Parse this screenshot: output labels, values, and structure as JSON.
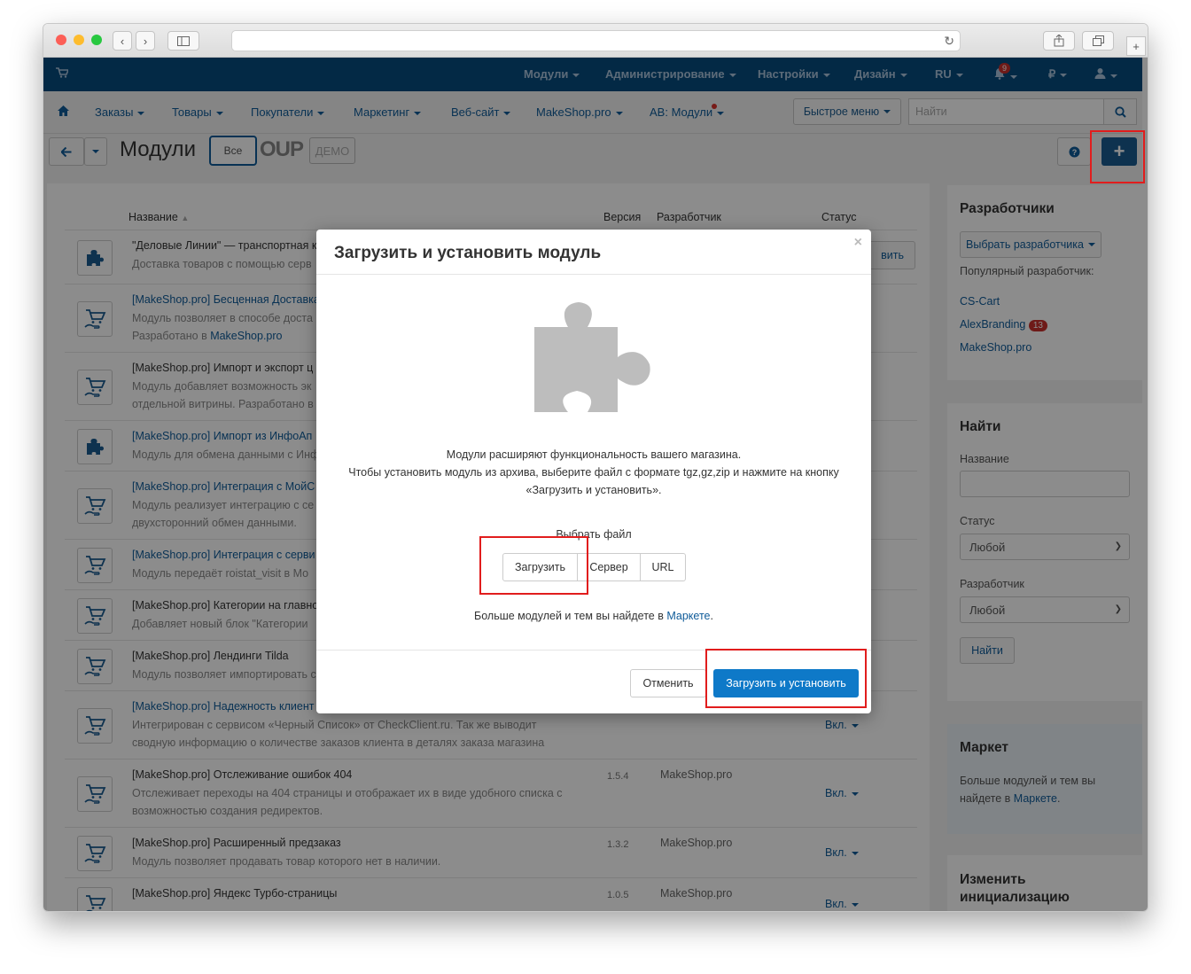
{
  "topbar": {
    "menu_modules": "Модули",
    "menu_admin": "Администрирование",
    "menu_settings": "Настройки",
    "menu_design": "Дизайн",
    "menu_lang": "RU",
    "notifications_count": "9",
    "menu_currency": "₽"
  },
  "nav": {
    "orders": "Заказы",
    "products": "Товары",
    "customers": "Покупатели",
    "marketing": "Маркетинг",
    "website": "Веб-сайт",
    "makeshop": "MakeShop.pro",
    "ab_modules": "AB: Модули",
    "quick_menu": "Быстрое меню",
    "search_placeholder": "Найти"
  },
  "page": {
    "title": "Модули",
    "tab_all": "Все",
    "logo_oup": "OUP",
    "logo_demo": "ДЕМО"
  },
  "table": {
    "col_name": "Название",
    "col_version": "Версия",
    "col_developer": "Разработчик",
    "col_status": "Статус",
    "rows": [
      {
        "title": "\"Деловые Линии\" — транспортная к",
        "desc1": "Доставка товаров с помощью серв",
        "desc2": ""
      },
      {
        "title": "[MakeShop.pro] Бесценная Доставка",
        "desc1": "Модуль позволяет в способе доста",
        "desc2": "Разработано в ",
        "link": "MakeShop.pro"
      },
      {
        "title": "[MakeShop.pro] Импорт и экспорт ц",
        "desc1": "Модуль добавляет возможность эк",
        "desc2": "отдельной витрины. Разработано в"
      },
      {
        "title": "[MakeShop.pro] Импорт из ИнфоАп",
        "desc1": "Модуль для обмена данными с Инф",
        "desc2": ""
      },
      {
        "title": "[MakeShop.pro] Интеграция с МойС",
        "desc1": "Модуль реализует интеграцию с се",
        "desc2": "двухсторонний обмен данными."
      },
      {
        "title": "[MakeShop.pro] Интеграция с серви",
        "desc1": "Модуль передаёт roistat_visit в Мо",
        "desc2": ""
      },
      {
        "title": "[MakeShop.pro] Категории на главно",
        "desc1": "Добавляет новый блок \"Категории",
        "desc2": ""
      },
      {
        "title": "[MakeShop.pro] Лендинги Tilda",
        "desc1": "Модуль позволяет импортировать с",
        "desc2": ""
      },
      {
        "title": "[MakeShop.pro] Надежность клиент",
        "desc1": "Интегрирован с сервисом «Черный Список» от CheckClient.ru. Так же выводит",
        "desc2": "сводную информацию о количестве заказов клиента в деталях заказа магазина",
        "status": "Вкл."
      },
      {
        "title": "[MakeShop.pro] Отслеживание ошибок 404",
        "desc1": "Отслеживает переходы на 404 страницы и отображает их в виде удобного списка с",
        "desc2": "возможностью создания редиректов.",
        "version": "1.5.4",
        "developer": "MakeShop.pro",
        "status": "Вкл."
      },
      {
        "title": "[MakeShop.pro] Расширенный предзаказ",
        "desc1": "Модуль позволяет продавать товар которого нет в наличии.",
        "desc2": "",
        "version": "1.3.2",
        "developer": "MakeShop.pro",
        "status": "Вкл."
      },
      {
        "title": "[MakeShop.pro] Яндекс Турбо-страницы",
        "desc1": "",
        "desc2": "",
        "version": "1.0.5",
        "developer": "MakeShop.pro",
        "status": "Вкл."
      }
    ],
    "row0_action": "вить"
  },
  "sidebar": {
    "developers_title": "Разработчики",
    "choose_developer": "Выбрать разработчика",
    "popular_label": "Популярный разработчик:",
    "dev1": "CS-Cart",
    "dev2": "AlexBranding",
    "dev2_count": "13",
    "dev3": "MakeShop.pro",
    "find_title": "Найти",
    "name_label": "Название",
    "status_label": "Статус",
    "status_value": "Любой",
    "developer_label": "Разработчик",
    "developer_value": "Любой",
    "find_button": "Найти",
    "market_title": "Маркет",
    "market_text1": "Больше модулей и тем вы",
    "market_text2": "найдете в ",
    "market_link": "Маркете",
    "init_title1": "Изменить",
    "init_title2": "инициализацию"
  },
  "modal": {
    "title": "Загрузить и установить модуль",
    "close": "×",
    "line1": "Модули расширяют функциональность вашего магазина.",
    "line2": "Чтобы установить модуль из архива, выберите файл с формате tgz,gz,zip и нажмите на кнопку",
    "line3": "«Загрузить и установить».",
    "choose_file": "Выбрать файл",
    "btn_upload": "Загрузить",
    "btn_server": "Сервер",
    "btn_url": "URL",
    "more_text": "Больше модулей и тем вы найдете в ",
    "more_link": "Маркете",
    "more_end": ".",
    "cancel": "Отменить",
    "install": "Загрузить и установить"
  },
  "colors": {
    "topbar": "#074c7e",
    "accent": "#0f5b99",
    "primary_button": "#0e79c8",
    "highlight": "#e11d1d"
  }
}
